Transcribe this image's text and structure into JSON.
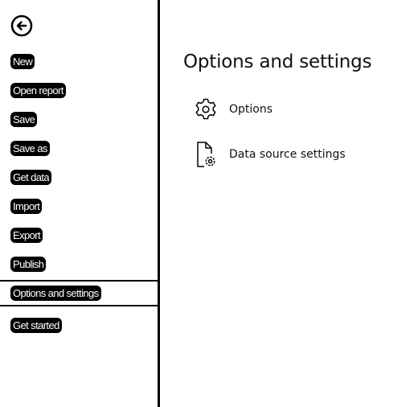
{
  "sidebar": {
    "back_icon": "back-arrow-circle-icon",
    "items": [
      {
        "label": "New"
      },
      {
        "label": "Open report"
      },
      {
        "label": "Save"
      },
      {
        "label": "Save as"
      },
      {
        "label": "Get data"
      },
      {
        "label": "Import"
      },
      {
        "label": "Export"
      },
      {
        "label": "Publish"
      },
      {
        "label": "Options and settings",
        "selected": true
      },
      {
        "label": "Get started"
      }
    ]
  },
  "main": {
    "title": "Options and settings",
    "options": [
      {
        "label": "Options",
        "icon": "gear-icon"
      },
      {
        "label": "Data source settings",
        "icon": "document-gear-icon"
      }
    ]
  },
  "colors": {
    "background": "#ffffff",
    "text": "#111111",
    "accent": "#000000"
  }
}
